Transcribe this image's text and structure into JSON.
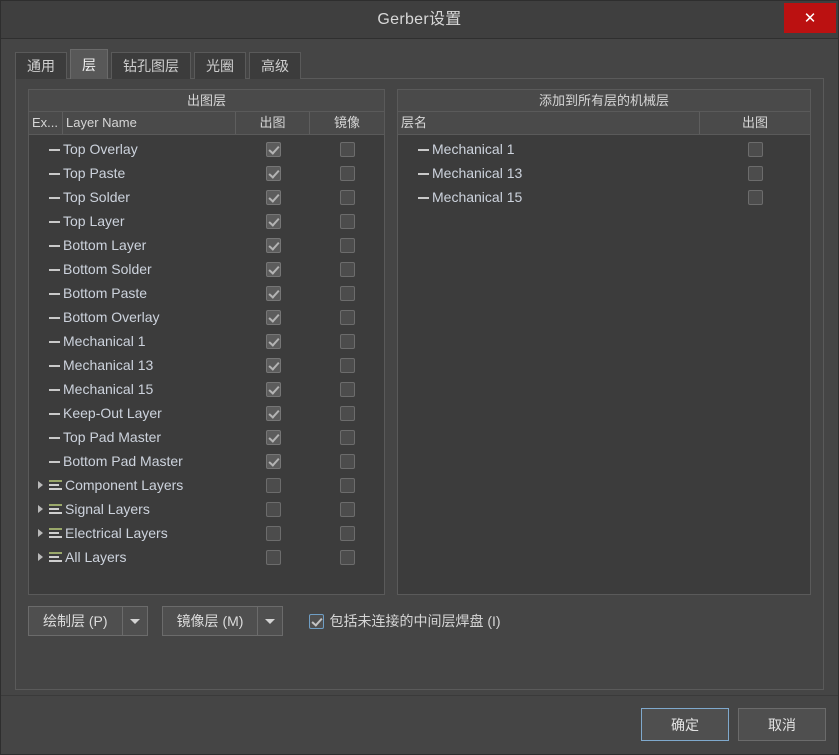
{
  "window": {
    "title": "Gerber设置",
    "close_label": "✕"
  },
  "tabs": [
    {
      "label": "通用",
      "active": false
    },
    {
      "label": "层",
      "active": true
    },
    {
      "label": "钻孔图层",
      "active": false
    },
    {
      "label": "光圈",
      "active": false
    },
    {
      "label": "高级",
      "active": false
    }
  ],
  "left_pane": {
    "title": "出图层",
    "columns": {
      "extension": "Ex...",
      "layer_name": "Layer Name",
      "plot": "出图",
      "mirror": "镜像"
    },
    "rows": [
      {
        "name": "Top Overlay",
        "type": "leaf",
        "plot": true,
        "mirror": false
      },
      {
        "name": "Top Paste",
        "type": "leaf",
        "plot": true,
        "mirror": false
      },
      {
        "name": "Top Solder",
        "type": "leaf",
        "plot": true,
        "mirror": false
      },
      {
        "name": "Top Layer",
        "type": "leaf",
        "plot": true,
        "mirror": false
      },
      {
        "name": "Bottom Layer",
        "type": "leaf",
        "plot": true,
        "mirror": false
      },
      {
        "name": "Bottom Solder",
        "type": "leaf",
        "plot": true,
        "mirror": false
      },
      {
        "name": "Bottom Paste",
        "type": "leaf",
        "plot": true,
        "mirror": false
      },
      {
        "name": "Bottom Overlay",
        "type": "leaf",
        "plot": true,
        "mirror": false
      },
      {
        "name": "Mechanical 1",
        "type": "leaf",
        "plot": true,
        "mirror": false
      },
      {
        "name": "Mechanical 13",
        "type": "leaf",
        "plot": true,
        "mirror": false
      },
      {
        "name": "Mechanical 15",
        "type": "leaf",
        "plot": true,
        "mirror": false
      },
      {
        "name": "Keep-Out Layer",
        "type": "leaf",
        "plot": true,
        "mirror": false
      },
      {
        "name": "Top Pad Master",
        "type": "leaf",
        "plot": true,
        "mirror": false
      },
      {
        "name": "Bottom Pad Master",
        "type": "leaf",
        "plot": true,
        "mirror": false
      },
      {
        "name": "Component Layers",
        "type": "group",
        "plot": false,
        "mirror": false
      },
      {
        "name": "Signal Layers",
        "type": "group",
        "plot": false,
        "mirror": false
      },
      {
        "name": "Electrical Layers",
        "type": "group",
        "plot": false,
        "mirror": false
      },
      {
        "name": "All Layers",
        "type": "group",
        "plot": false,
        "mirror": false
      }
    ]
  },
  "right_pane": {
    "title": "添加到所有层的机械层",
    "columns": {
      "layer_name": "层名",
      "plot": "出图"
    },
    "rows": [
      {
        "name": "Mechanical 1",
        "type": "leaf",
        "plot": false
      },
      {
        "name": "Mechanical 13",
        "type": "leaf",
        "plot": false
      },
      {
        "name": "Mechanical 15",
        "type": "leaf",
        "plot": false
      }
    ]
  },
  "bottom_controls": {
    "plot_layers_button": "绘制层 (P)",
    "mirror_layers_button": "镜像层 (M)",
    "include_pads_label": "包括未连接的中间层焊盘 (I)",
    "include_pads_checked": true
  },
  "footer": {
    "ok_label": "确定",
    "cancel_label": "取消"
  },
  "colors": {
    "window_bg": "#454545",
    "pane_bg": "#3c3c3c",
    "header_bg": "#4a4a4a",
    "close_red": "#bb1111",
    "accent_blue": "#7fa9cd",
    "text": "#d6d6d6",
    "layer_text": "#cdd3dd"
  }
}
